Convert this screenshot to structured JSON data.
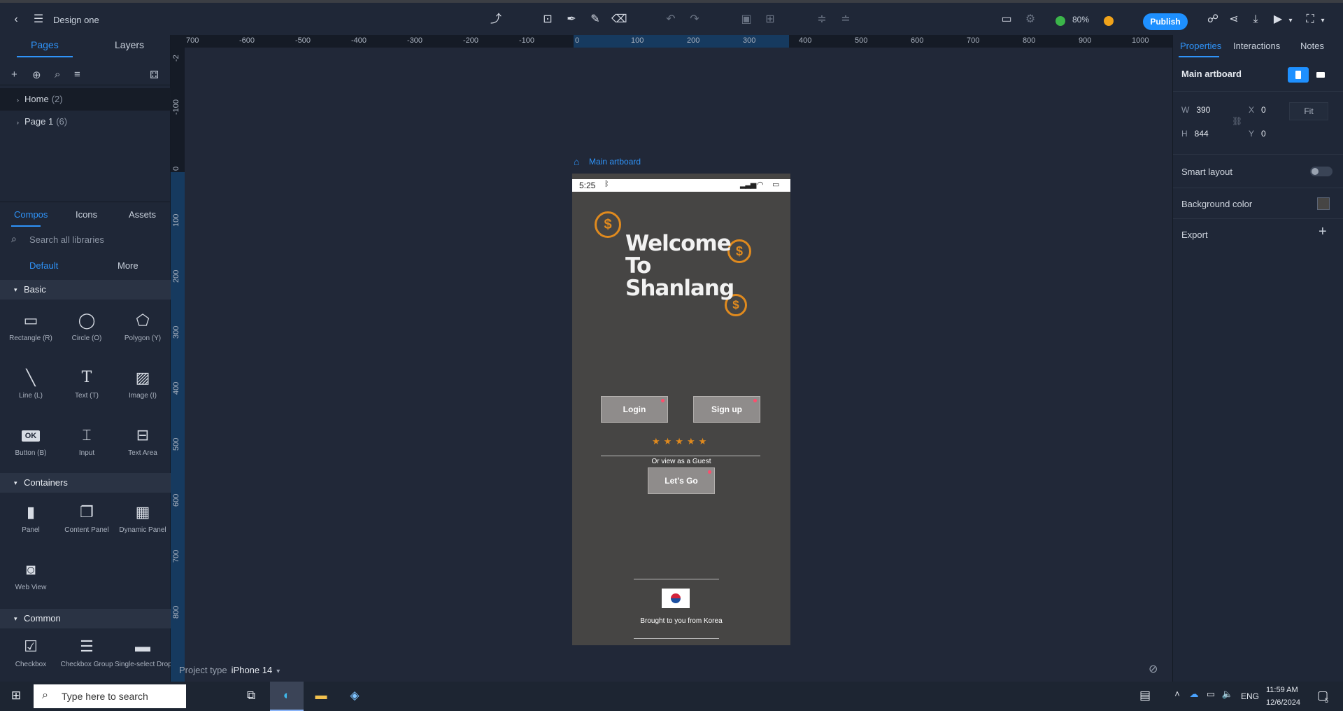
{
  "toolbar": {
    "doc_title": "Design one",
    "zoom": "80%",
    "publish_label": "Publish"
  },
  "left_panel": {
    "tabs": [
      "Pages",
      "Layers"
    ],
    "pages": [
      {
        "name": "Home",
        "count": "(2)"
      },
      {
        "name": "Page 1",
        "count": "(6)"
      }
    ],
    "lib_tabs": [
      "Compos",
      "Icons",
      "Assets"
    ],
    "search_placeholder": "Search all libraries",
    "sub_tabs": [
      "Default",
      "More"
    ],
    "sections": {
      "basic": "Basic",
      "containers": "Containers",
      "common": "Common"
    },
    "basic_items": [
      "Rectangle (R)",
      "Circle (O)",
      "Polygon (Y)",
      "Line (L)",
      "Text (T)",
      "Image (I)",
      "Button (B)",
      "Input",
      "Text Area"
    ],
    "container_items": [
      "Panel",
      "Content Panel",
      "Dynamic Panel",
      "Web View"
    ],
    "common_items": [
      "Checkbox",
      "Checkbox Group",
      "Single-select Droplist"
    ],
    "button_glyph_text": "OK"
  },
  "ruler": {
    "top": [
      "700",
      "-600",
      "-500",
      "-400",
      "-300",
      "-200",
      "-100",
      "0",
      "100",
      "200",
      "300",
      "400",
      "500",
      "600",
      "700",
      "800",
      "900",
      "1000"
    ],
    "left": [
      "-2",
      "-100",
      "0",
      "100",
      "200",
      "300",
      "400",
      "500",
      "600",
      "700",
      "800"
    ]
  },
  "canvas": {
    "artboard_label": "Main artboard",
    "project_type_label": "Project type",
    "project_type_value": "iPhone 14"
  },
  "phone": {
    "time": "5:25",
    "welcome_lines": [
      "Welcome",
      "To",
      "Shanlang"
    ],
    "coin_symbol": "$",
    "login": "Login",
    "signup": "Sign up",
    "stars": "★★★★★",
    "guest_text": "Or view as a Guest",
    "lets_go": "Let's Go",
    "footer": "Brought to you from Korea"
  },
  "right_panel": {
    "tabs": [
      "Properties",
      "Interactions",
      "Notes"
    ],
    "section_title": "Main artboard",
    "w_label": "W",
    "w_value": "390",
    "h_label": "H",
    "h_value": "844",
    "x_label": "X",
    "x_value": "0",
    "y_label": "Y",
    "y_value": "0",
    "fit_label": "Fit",
    "smart_layout": "Smart layout",
    "background_color": "Background color",
    "export": "Export",
    "plus": "+"
  },
  "taskbar": {
    "search_placeholder": "Type here to search",
    "language": "ENG",
    "time": "11:59 AM",
    "date": "12/6/2024",
    "notifications": "5"
  },
  "colors": {
    "accent": "#2f93f8",
    "publish": "#1e90ff",
    "coin": "#e08a1e",
    "phone_bg": "#464544"
  }
}
